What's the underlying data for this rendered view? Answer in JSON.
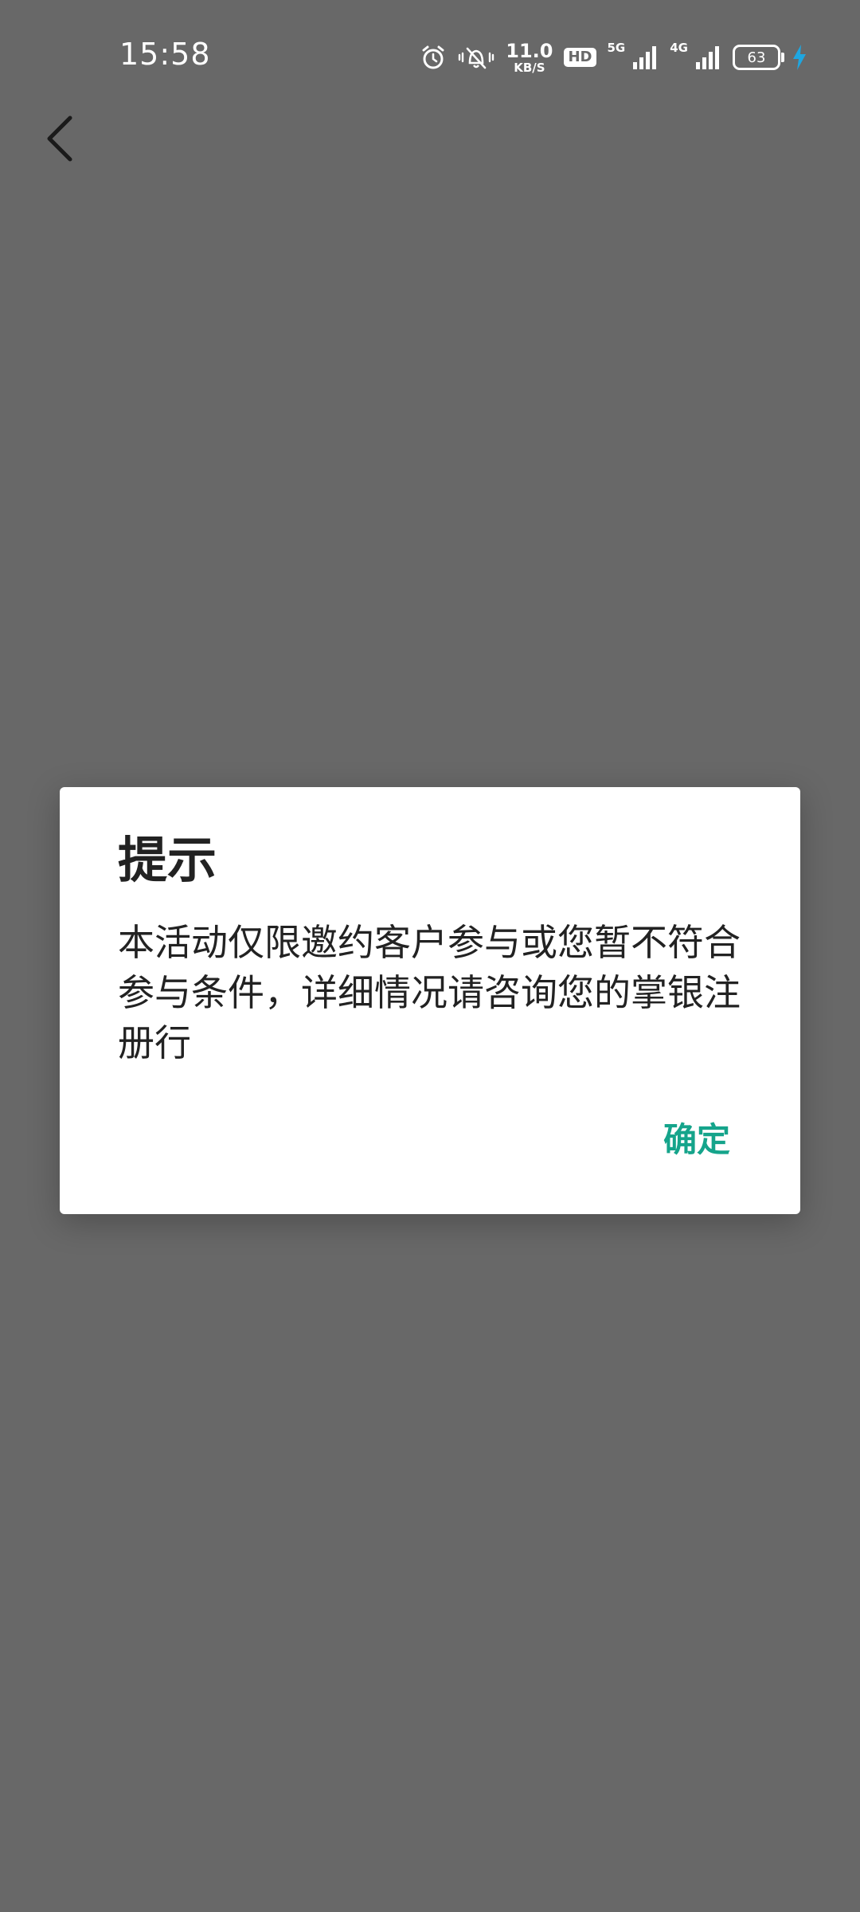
{
  "status_bar": {
    "time": "15:58",
    "net_speed_value": "11.0",
    "net_speed_unit": "KB/S",
    "hd_label": "HD",
    "network_5g_label": "5G",
    "network_4g_label": "4G",
    "battery_level": "63",
    "icons": [
      "alarm-icon",
      "vibrate-silent-icon",
      "signal-icon",
      "charging-icon"
    ]
  },
  "nav": {
    "back_icon": "chevron-left-icon"
  },
  "dialog": {
    "title": "提示",
    "message": "本活动仅限邀约客户参与或您暂不符合参与条件，详细情况请咨询您的掌银注册行",
    "confirm_label": "确定",
    "accent_color": "#15a48b"
  }
}
